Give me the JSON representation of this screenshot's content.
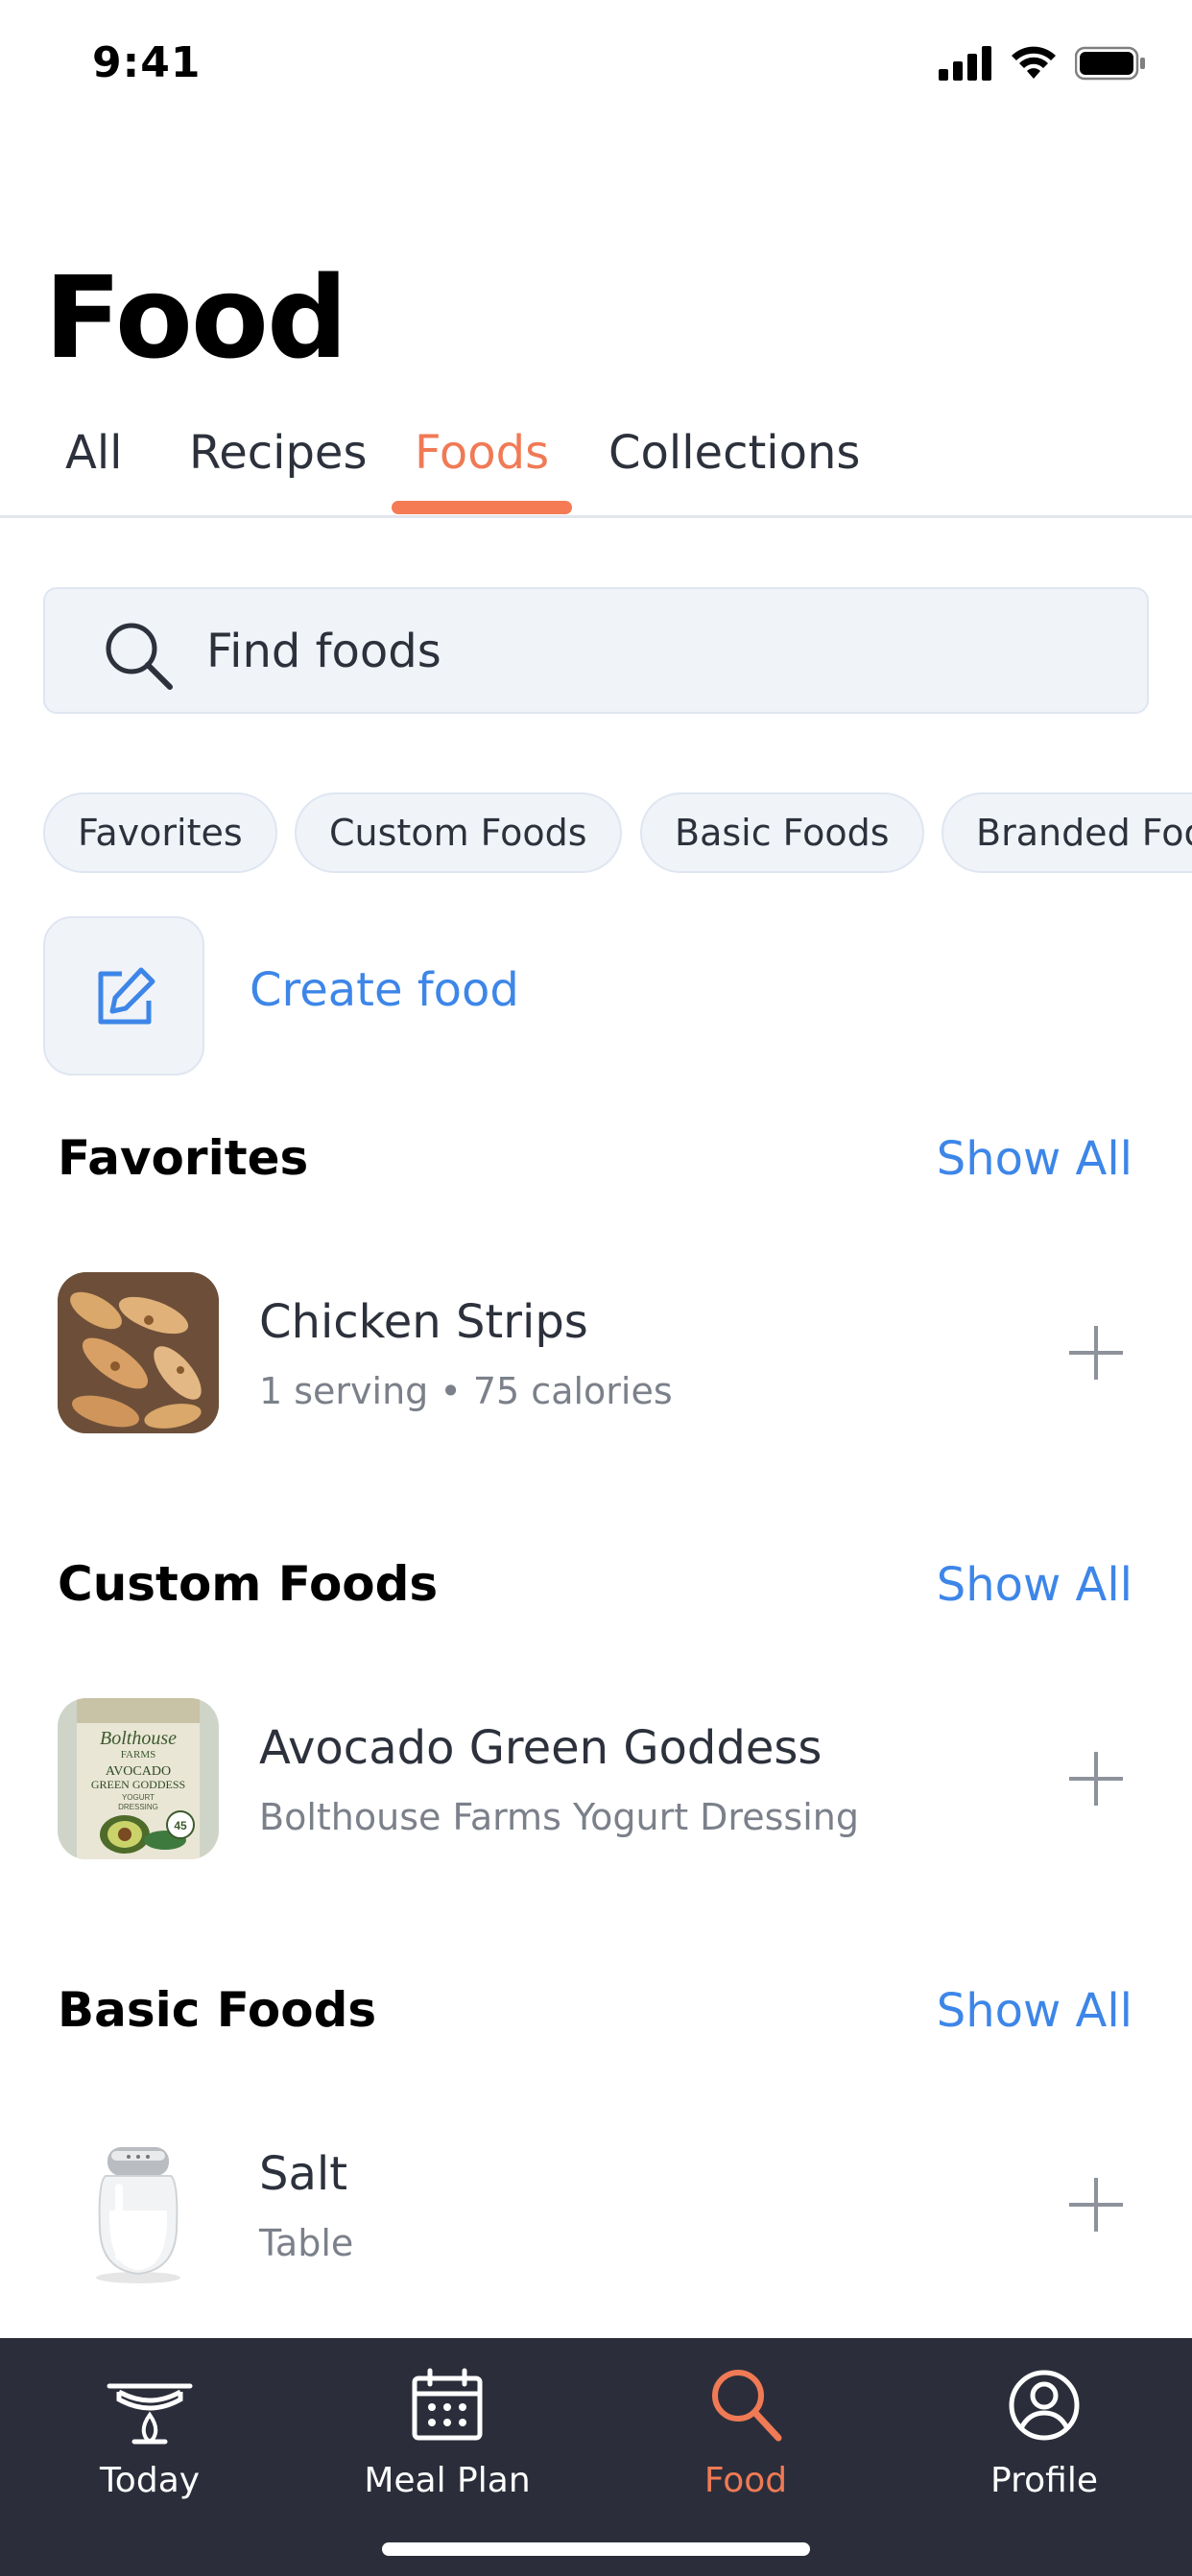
{
  "status_bar": {
    "time": "9:41"
  },
  "page": {
    "title": "Food"
  },
  "tabs": [
    {
      "label": "All"
    },
    {
      "label": "Recipes"
    },
    {
      "label": "Foods",
      "active": true
    },
    {
      "label": "Collections"
    }
  ],
  "search": {
    "placeholder": "Find foods"
  },
  "chips": [
    {
      "label": "Favorites"
    },
    {
      "label": "Custom Foods"
    },
    {
      "label": "Basic Foods"
    },
    {
      "label": "Branded Foods"
    }
  ],
  "create": {
    "label": "Create food"
  },
  "sections": [
    {
      "title": "Favorites",
      "show_all": "Show All",
      "item": {
        "name": "Chicken Strips",
        "sub": "1 serving • 75 calories",
        "thumb": "grilled-chicken-photo"
      }
    },
    {
      "title": "Custom Foods",
      "show_all": "Show All",
      "item": {
        "name": "Avocado Green Goddess",
        "sub": "Bolthouse Farms Yogurt Dressing",
        "thumb": "dressing-bottle-photo",
        "label_text": {
          "brand": "Bolthouse",
          "farms": "FARMS",
          "line1": "AVOCADO",
          "line2": "GREEN GODDESS",
          "line3": "YOGURT",
          "line4": "DRESSING",
          "badge": "45"
        }
      }
    },
    {
      "title": "Basic Foods",
      "show_all": "Show All",
      "item": {
        "name": "Salt",
        "sub": "Table",
        "thumb": "salt-shaker-photo"
      }
    }
  ],
  "nav": [
    {
      "label": "Today",
      "icon": "today-pot-icon"
    },
    {
      "label": "Meal Plan",
      "icon": "calendar-icon"
    },
    {
      "label": "Food",
      "icon": "search-icon",
      "active": true
    },
    {
      "label": "Profile",
      "icon": "profile-icon"
    }
  ],
  "colors": {
    "accent": "#f47b53",
    "link": "#3d86e8",
    "nav_bg": "#2b2e3a"
  }
}
